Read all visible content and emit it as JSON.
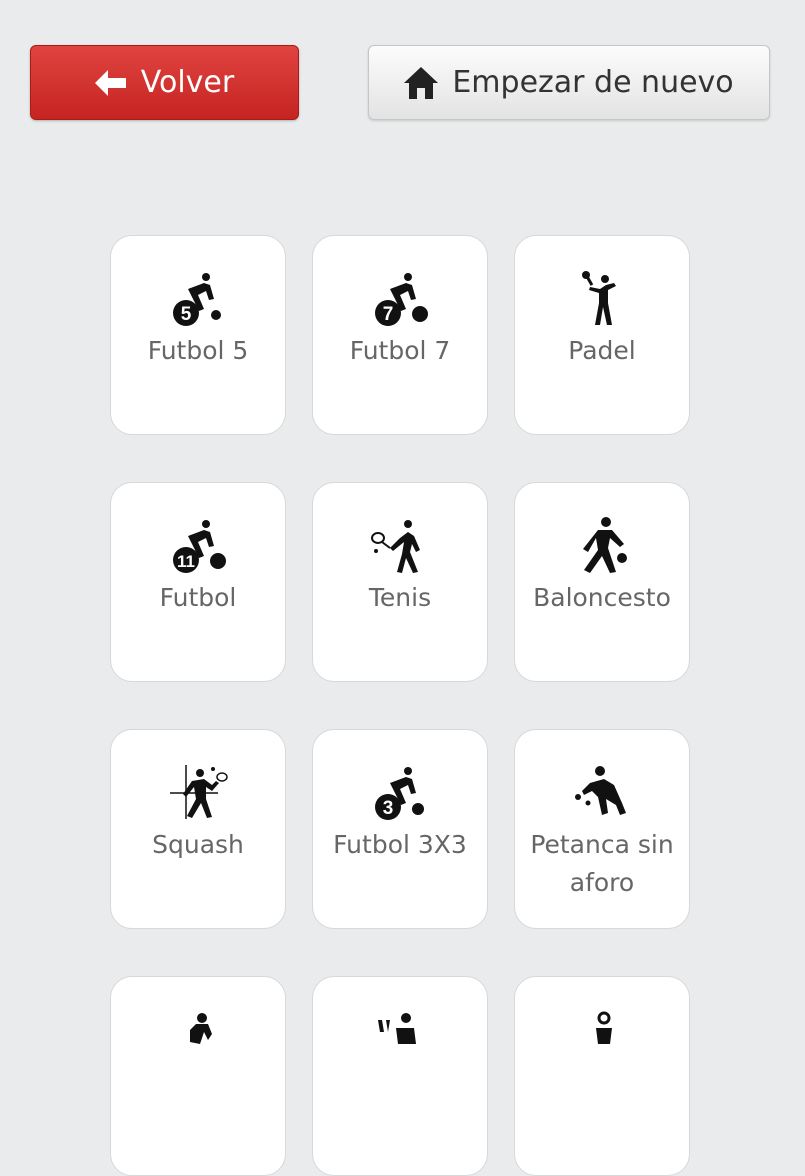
{
  "header": {
    "back_label": "Volver",
    "back_icon": "arrow-left-icon",
    "restart_label": "Empezar de nuevo",
    "restart_icon": "home-icon"
  },
  "colors": {
    "background": "#e9ebec",
    "back_button": "#d1302c",
    "card_text": "#666666"
  },
  "sports": [
    {
      "label": "Futbol 5",
      "icon": "football-5-icon"
    },
    {
      "label": "Futbol 7",
      "icon": "football-7-icon"
    },
    {
      "label": "Padel",
      "icon": "padel-icon"
    },
    {
      "label": "Futbol",
      "icon": "football-11-icon"
    },
    {
      "label": "Tenis",
      "icon": "tennis-icon"
    },
    {
      "label": "Baloncesto",
      "icon": "basketball-icon"
    },
    {
      "label": "Squash",
      "icon": "squash-icon"
    },
    {
      "label": "Futbol 3X3",
      "icon": "football-3-icon"
    },
    {
      "label": "Petanca sin aforo",
      "icon": "petanque-icon"
    },
    {
      "label": "",
      "icon": "sport-icon"
    },
    {
      "label": "",
      "icon": "sport-icon"
    },
    {
      "label": "",
      "icon": "sport-icon"
    }
  ]
}
